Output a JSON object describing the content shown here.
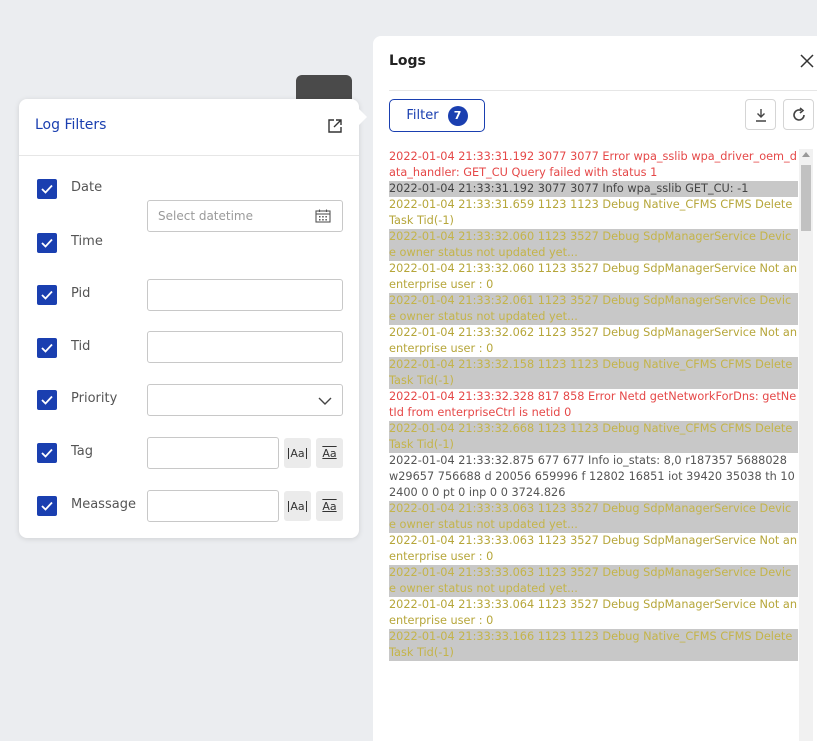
{
  "filters": {
    "title": "Log Filters",
    "date_label": "Date",
    "time_label": "Time",
    "datetime_placeholder": "Select datetime",
    "pid_label": "Pid",
    "tid_label": "Tid",
    "priority_label": "Priority",
    "tag_label": "Tag",
    "message_label": "Meassage",
    "case_btn": "Aa",
    "whole_btn": "Aa"
  },
  "logs": {
    "title": "Logs",
    "filter_label": "Filter",
    "filter_count": "7",
    "rows": [
      {
        "text": "2022-01-04 21:33:31.192 3077 3077 Error wpa_sslib wpa_driver_oem_data_handler: GET_CU Query failed with status 1",
        "level": "error",
        "alt": false
      },
      {
        "text": "2022-01-04 21:33:31.192 3077 3077 Info wpa_sslib GET_CU: -1",
        "level": "info",
        "alt": true
      },
      {
        "text": "2022-01-04 21:33:31.659 1123 1123 Debug Native_CFMS CFMS Delete Task Tid(-1)",
        "level": "debug",
        "alt": false
      },
      {
        "text": "2022-01-04 21:33:32.060 1123 3527 Debug SdpManagerService Device owner status not updated yet...",
        "level": "debug",
        "alt": true
      },
      {
        "text": "2022-01-04 21:33:32.060 1123 3527 Debug SdpManagerService Not an enterprise user : 0",
        "level": "debug",
        "alt": false
      },
      {
        "text": "2022-01-04 21:33:32.061 1123 3527 Debug SdpManagerService Device owner status not updated yet...",
        "level": "debug",
        "alt": true
      },
      {
        "text": "2022-01-04 21:33:32.062 1123 3527 Debug SdpManagerService Not an enterprise user : 0",
        "level": "debug",
        "alt": false
      },
      {
        "text": "2022-01-04 21:33:32.158 1123 1123 Debug Native_CFMS CFMS Delete Task Tid(-1)",
        "level": "debug",
        "alt": true
      },
      {
        "text": "2022-01-04 21:33:32.328 817 858 Error Netd getNetworkForDns: getNetId from enterpriseCtrl is netid 0",
        "level": "error",
        "alt": false
      },
      {
        "text": "2022-01-04 21:33:32.668 1123 1123 Debug Native_CFMS CFMS Delete Task Tid(-1)",
        "level": "debug",
        "alt": true
      },
      {
        "text": "2022-01-04 21:33:32.875 677 677 Info io_stats: 8,0 r187357 5688028 w29657 756688 d 20056 659996 f 12802 16851 iot 39420 35038 th 102400 0 0 pt 0 inp 0 0 3724.826",
        "level": "info",
        "alt": false
      },
      {
        "text": "2022-01-04 21:33:33.063 1123 3527 Debug SdpManagerService Device owner status not updated yet...",
        "level": "debug",
        "alt": true
      },
      {
        "text": "2022-01-04 21:33:33.063 1123 3527 Debug SdpManagerService Not an enterprise user : 0",
        "level": "debug",
        "alt": false
      },
      {
        "text": "2022-01-04 21:33:33.063 1123 3527 Debug SdpManagerService Device owner status not updated yet...",
        "level": "debug",
        "alt": true
      },
      {
        "text": "2022-01-04 21:33:33.064 1123 3527 Debug SdpManagerService Not an enterprise user : 0",
        "level": "debug",
        "alt": false
      },
      {
        "text": "2022-01-04 21:33:33.166 1123 1123 Debug Native_CFMS CFMS Delete Task Tid(-1)",
        "level": "debug",
        "alt": true
      }
    ]
  }
}
